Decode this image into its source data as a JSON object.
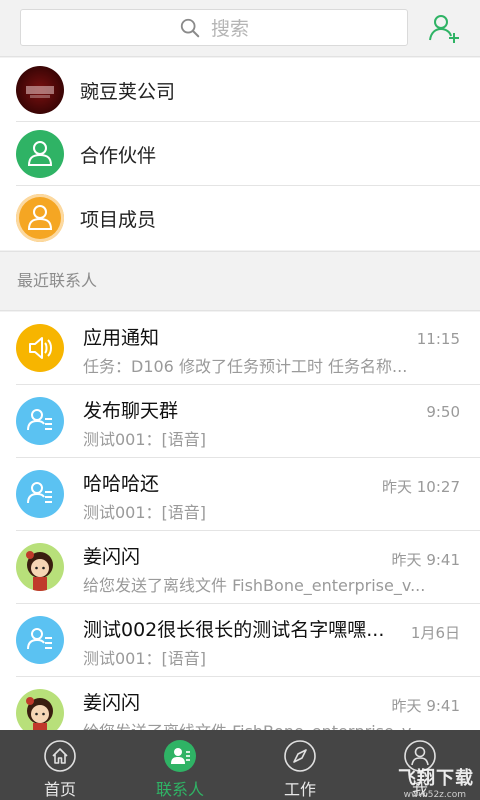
{
  "search": {
    "placeholder": "搜索"
  },
  "groups": [
    {
      "label": "豌豆荚公司",
      "avatar_icon": "company-logo"
    },
    {
      "label": "合作伙伴",
      "avatar_icon": "person-icon",
      "color": "#2fb365"
    },
    {
      "label": "项目成员",
      "avatar_icon": "person-icon",
      "color": "#f5a623"
    }
  ],
  "recent_header": "最近联系人",
  "recent": [
    {
      "name": "应用通知",
      "time": "11:15",
      "message": "任务：D106 修改了任务预计工时 任务名称...",
      "avatar_icon": "speaker-icon",
      "color": "#f7b500"
    },
    {
      "name": "发布聊天群",
      "time": "9:50",
      "message": "测试001：[语音]",
      "avatar_icon": "group-chat-icon",
      "color": "#5bc2f2"
    },
    {
      "name": "哈哈哈还",
      "time": "昨天 10:27",
      "message": "测试001：[语音]",
      "avatar_icon": "group-chat-icon",
      "color": "#5bc2f2"
    },
    {
      "name": "姜闪闪",
      "time": "昨天 9:41",
      "message": "给您发送了离线文件 FishBone_enterprise_v...",
      "avatar_icon": "cartoon-girl-avatar"
    },
    {
      "name": "测试002很长很长的测试名字嘿嘿...",
      "time": "1月6日",
      "message": "测试001：[语音]",
      "avatar_icon": "group-chat-icon",
      "color": "#5bc2f2"
    },
    {
      "name": "姜闪闪",
      "time": "昨天 9:41",
      "message": "给您发送了离线文件 FishBone_enterprise_v...",
      "avatar_icon": "cartoon-girl-avatar"
    }
  ],
  "tabs": [
    {
      "label": "首页",
      "icon": "home-icon"
    },
    {
      "label": "联系人",
      "icon": "contacts-icon",
      "active": true
    },
    {
      "label": "工作",
      "icon": "compass-icon"
    },
    {
      "label": "我",
      "icon": "profile-icon"
    }
  ],
  "watermark": {
    "text": "飞翔下载",
    "sub": "www.52z.com"
  },
  "colors": {
    "accent": "#2fb365",
    "tabbar": "#454545"
  }
}
